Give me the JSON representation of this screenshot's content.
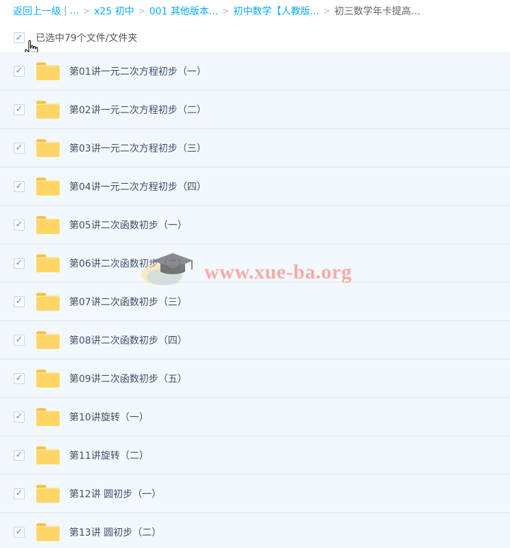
{
  "breadcrumb": {
    "back_label": "返回上一级",
    "ellipsis": "...",
    "separator": ">",
    "items": [
      "x25 初中",
      "001 其他版本...",
      "初中数学【人教版...",
      "初三数学年卡提高..."
    ]
  },
  "selection": {
    "label": "已选中79个文件/文件夹",
    "checked": true
  },
  "files": [
    "第01讲一元二次方程初步（一）",
    "第02讲一元二次方程初步（二）",
    "第03讲一元二次方程初步（三）",
    "第04讲一元二次方程初步（四）",
    "第05讲二次函数初步（一）",
    "第06讲二次函数初步（二）",
    "第07讲二次函数初步（三）",
    "第08讲二次函数初步（四）",
    "第09讲二次函数初步（五）",
    "第10讲旋转（一）",
    "第11讲旋转（二）",
    "第12讲 圆初步（一）",
    "第13讲 圆初步（二）"
  ],
  "watermark": {
    "text": "www.xue-ba.org"
  },
  "icons": {
    "checkbox": "checkmark-icon",
    "folder": "folder-icon",
    "cursor": "hand-pointer-icon",
    "watermark_logo": "graduation-cap-icon"
  },
  "colors": {
    "link": "#09AAFF",
    "row_background": "#f2f8fe",
    "row_border": "#dfe8f1",
    "folder": "#ffd665",
    "checkmark": "#3b8cff",
    "watermark": "#f6968c"
  }
}
